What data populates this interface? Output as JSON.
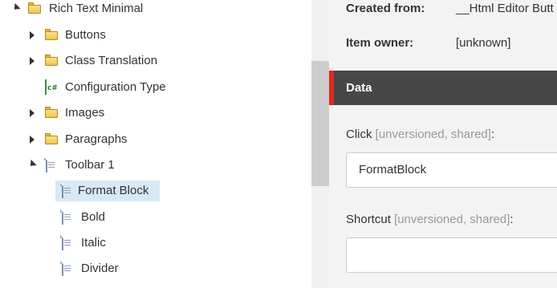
{
  "tree": {
    "items": [
      {
        "label": "Rich Text Minimal",
        "icon": "folder-icon",
        "toggle": "expanded"
      },
      {
        "label": "Buttons",
        "icon": "folder-icon",
        "toggle": "collapsed"
      },
      {
        "label": "Class Translation",
        "icon": "folder-icon",
        "toggle": "collapsed"
      },
      {
        "label": "Configuration Type",
        "icon": "config-type-icon",
        "toggle": "none"
      },
      {
        "label": "Images",
        "icon": "folder-icon",
        "toggle": "collapsed"
      },
      {
        "label": "Paragraphs",
        "icon": "folder-icon",
        "toggle": "collapsed"
      },
      {
        "label": "Toolbar 1",
        "icon": "document-icon",
        "toggle": "expanded"
      },
      {
        "label": "Format Block",
        "icon": "document-icon",
        "toggle": "none",
        "selected": true
      },
      {
        "label": "Bold",
        "icon": "document-icon",
        "toggle": "none"
      },
      {
        "label": "Italic",
        "icon": "document-icon",
        "toggle": "none"
      },
      {
        "label": "Divider",
        "icon": "document-icon",
        "toggle": "none"
      }
    ]
  },
  "info": {
    "created_from_label": "Created from:",
    "created_from_value": "__Html Editor Butt",
    "item_owner_label": "Item owner:",
    "item_owner_value": "[unknown]"
  },
  "section": {
    "title": "Data",
    "accent_color": "#dc291e"
  },
  "fields": {
    "click": {
      "label": "Click",
      "meta": "[unversioned, shared]",
      "colon": ":",
      "value": "FormatBlock"
    },
    "shortcut": {
      "label": "Shortcut",
      "meta": "[unversioned, shared]",
      "colon": ":",
      "value": ""
    }
  }
}
